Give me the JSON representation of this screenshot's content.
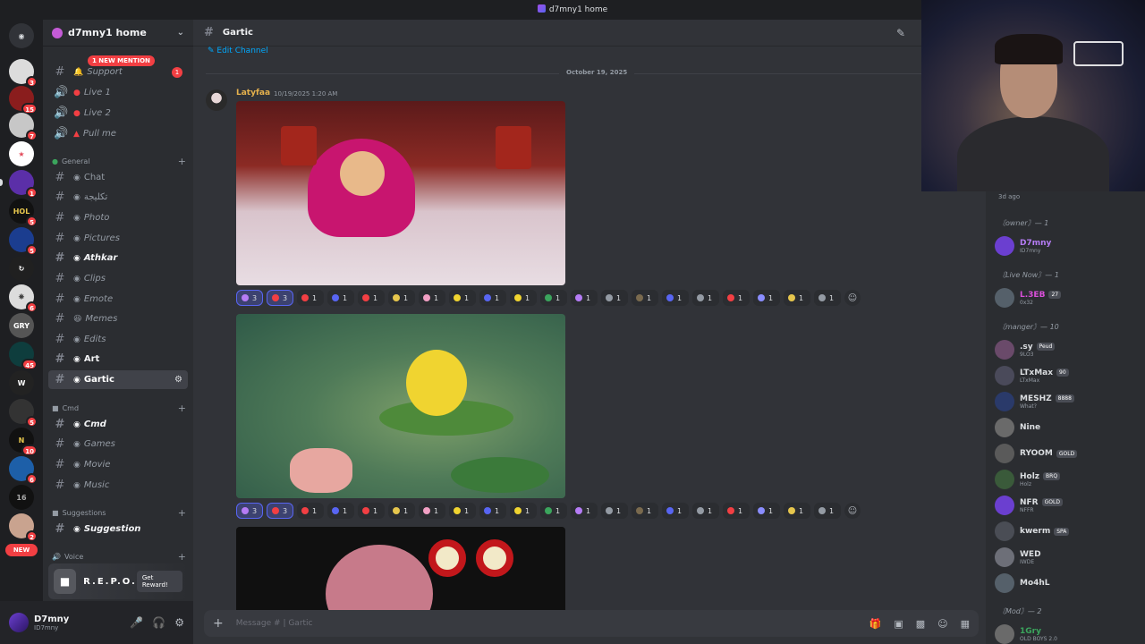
{
  "window_title": "d7mny1 home",
  "server": {
    "name": "d7mny1 home",
    "mention_banner": "1 NEW MENTION"
  },
  "rail": {
    "badges": [
      "3",
      "15",
      "7",
      "1",
      "5",
      "5",
      "6",
      "45",
      "5",
      "10",
      "6",
      "2"
    ],
    "new_tag": "NEW"
  },
  "channels": [
    {
      "name": "Support",
      "type": "text",
      "icon": "bell"
    },
    {
      "name": "Live 1",
      "type": "voice",
      "icon": "red-dot"
    },
    {
      "name": "Live 2",
      "type": "voice",
      "icon": "red-dot"
    },
    {
      "name": "Pull me",
      "type": "voice",
      "icon": "red-triangle"
    }
  ],
  "categories": {
    "general": "General",
    "cmd": "Cmd",
    "suggestions": "Suggestions",
    "voice": "Voice"
  },
  "general_channels": [
    {
      "name": "Chat",
      "unread": false
    },
    {
      "name": "تكليجة",
      "unread": false
    },
    {
      "name": "Photo",
      "unread": false
    },
    {
      "name": "Pictures",
      "unread": false
    },
    {
      "name": "Athkar",
      "unread": true
    },
    {
      "name": "Clips",
      "unread": false
    },
    {
      "name": "Emote",
      "unread": false
    },
    {
      "name": "Memes",
      "unread": false
    },
    {
      "name": "Edits",
      "unread": false
    },
    {
      "name": "Art",
      "unread": true
    },
    {
      "name": "Gartic",
      "unread": false,
      "active": true
    }
  ],
  "cmd_channels": [
    {
      "name": "Cmd",
      "unread": true
    },
    {
      "name": "Games",
      "unread": false
    },
    {
      "name": "Movie",
      "unread": false
    },
    {
      "name": "Music",
      "unread": false
    }
  ],
  "suggestion_channels": [
    {
      "name": "Suggestion",
      "unread": true
    }
  ],
  "promo": {
    "title": "R.E.P.O.",
    "button": "Get Reward!"
  },
  "user": {
    "name": "D7mny",
    "tag": "ID7mny"
  },
  "chat": {
    "channel_title": "Gartic",
    "edit_channel": "Edit Channel",
    "date_divider": "October 19, 2025",
    "author": "Latyfaa",
    "timestamp": "10/19/2025 1:20 AM",
    "composer_placeholder": "Message # | Gartic",
    "reactions1": [
      "3",
      "3",
      "1",
      "1",
      "1",
      "1",
      "1",
      "1",
      "1",
      "1",
      "1",
      "1",
      "1",
      "1",
      "1",
      "1",
      "1",
      "1",
      "1",
      "1"
    ],
    "reactions2": [
      "3",
      "3",
      "1",
      "1",
      "1",
      "1",
      "1",
      "1",
      "1",
      "1",
      "1",
      "1",
      "1",
      "1",
      "1",
      "1",
      "1",
      "1",
      "1",
      "1"
    ]
  },
  "members": {
    "last_seen": "3d ago",
    "groups": [
      {
        "label": "〘owner〙— 1",
        "items": [
          {
            "name": "D7mny",
            "sub": "ID7mny",
            "color": "#b57cf5"
          }
        ]
      },
      {
        "label": "〘Live Now〙— 1",
        "items": [
          {
            "name": "L.3EB",
            "sub": "0x32",
            "color": "#d94fd9",
            "tag": "27"
          }
        ]
      },
      {
        "label": "〘manger〙— 10",
        "items": [
          {
            "name": ".sy",
            "sub": "9LO3",
            "color": "#dbdee1",
            "tag": "Peud"
          },
          {
            "name": "LTxMax",
            "sub": "LTxMax",
            "color": "#dbdee1",
            "tag": "90"
          },
          {
            "name": "MESHZ",
            "sub": "What?",
            "color": "#dbdee1",
            "tag": "8888"
          },
          {
            "name": "Nine",
            "sub": "",
            "color": "#dbdee1"
          },
          {
            "name": "RYOOM",
            "sub": "",
            "color": "#dbdee1",
            "tag": "GOLD"
          },
          {
            "name": "Holz",
            "sub": "Holz",
            "color": "#dbdee1",
            "tag": "BRQ"
          },
          {
            "name": "NFR",
            "sub": "NFFR",
            "color": "#dbdee1",
            "tag": "GOLD"
          },
          {
            "name": "kwerm",
            "sub": "",
            "color": "#dbdee1",
            "tag": "SPA"
          },
          {
            "name": "WED",
            "sub": "IWDE",
            "color": "#dbdee1"
          },
          {
            "name": "Mo4hL",
            "sub": "",
            "color": "#dbdee1"
          }
        ]
      },
      {
        "label": "〘Mod〙— 2",
        "items": [
          {
            "name": "1Gry",
            "sub": "OLD BOYS 2.0",
            "color": "#3ba55d"
          }
        ]
      }
    ]
  }
}
